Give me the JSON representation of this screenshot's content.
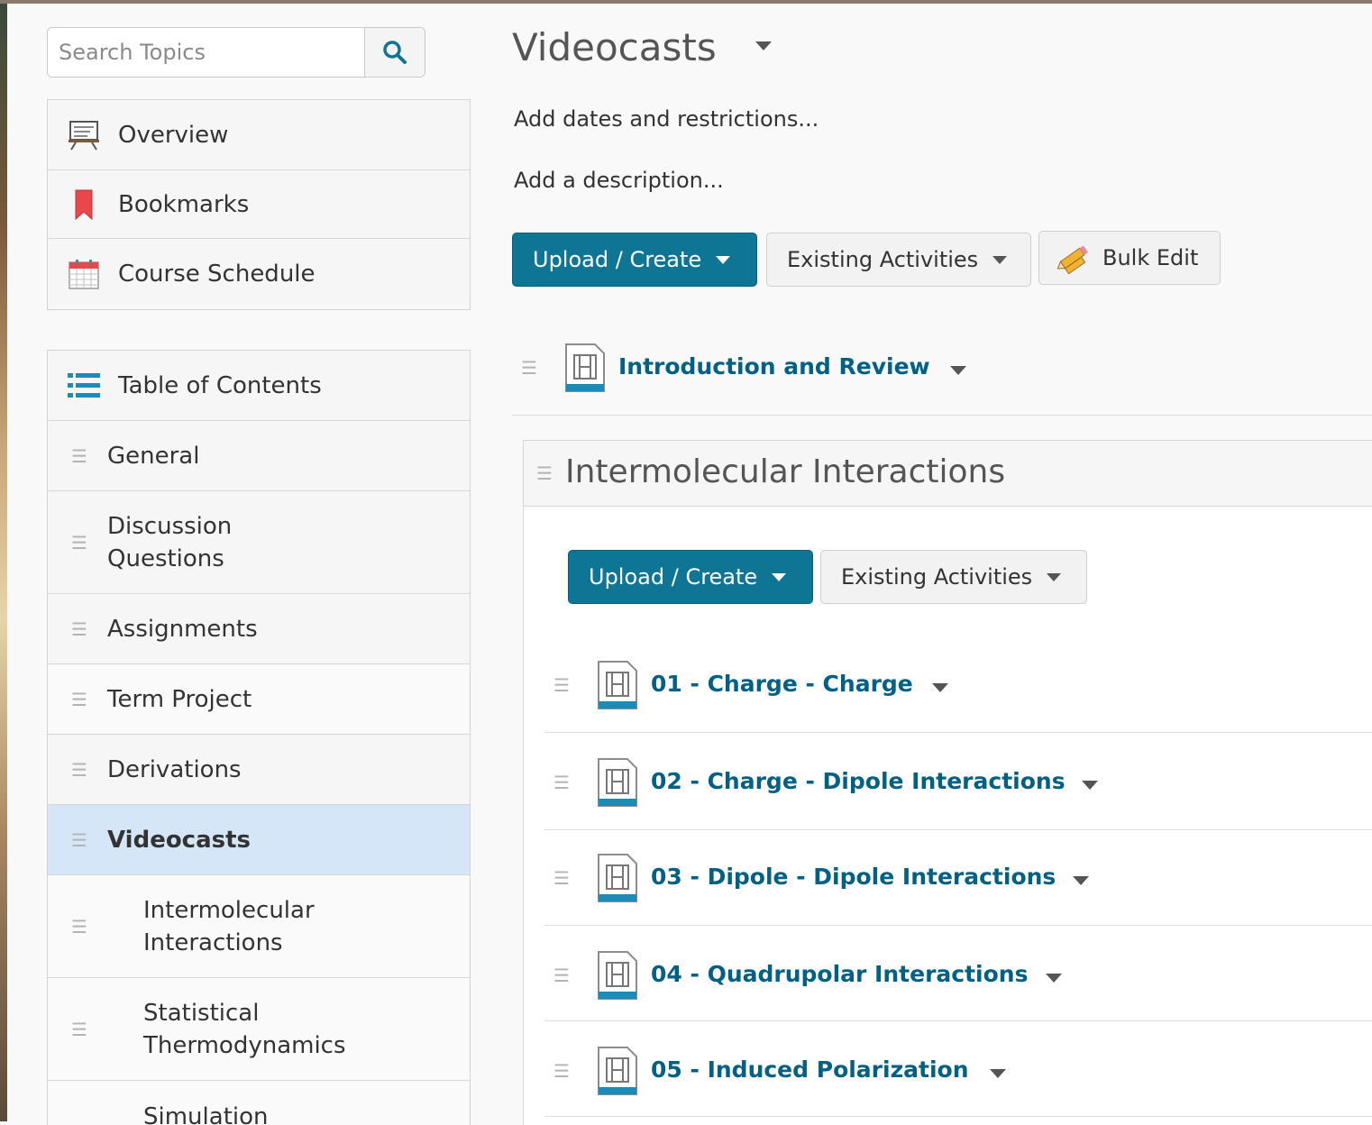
{
  "search": {
    "placeholder": "Search Topics"
  },
  "nav": {
    "items": [
      {
        "label": "Overview",
        "icon": "presentation-board-icon"
      },
      {
        "label": "Bookmarks",
        "icon": "bookmark-icon"
      },
      {
        "label": "Course Schedule",
        "icon": "calendar-icon"
      }
    ]
  },
  "toc": {
    "header": "Table of Contents",
    "items": [
      {
        "label": "General"
      },
      {
        "label": "Discussion\nQuestions"
      },
      {
        "label": "Assignments"
      },
      {
        "label": "Term Project"
      },
      {
        "label": "Derivations"
      },
      {
        "label": "Videocasts"
      },
      {
        "label": "Intermolecular\nInteractions"
      },
      {
        "label": "Statistical\nThermodynamics"
      },
      {
        "label": "Simulation"
      }
    ]
  },
  "main": {
    "title": "Videocasts",
    "add_dates": "Add dates and restrictions...",
    "add_description": "Add a description...",
    "toolbar": {
      "upload_label": "Upload / Create",
      "existing_label": "Existing Activities",
      "bulk_label": "Bulk Edit"
    },
    "topics": [
      {
        "title": "Introduction and Review"
      }
    ],
    "module": {
      "title": "Intermolecular Interactions",
      "toolbar": {
        "upload_label": "Upload / Create",
        "existing_label": "Existing Activities"
      },
      "topics": [
        {
          "title": "01 - Charge - Charge"
        },
        {
          "title": "02 - Charge - Dipole Interactions"
        },
        {
          "title": "03 - Dipole - Dipole Interactions"
        },
        {
          "title": "04 - Quadrupolar Interactions"
        },
        {
          "title": "05 - Induced Polarization"
        }
      ]
    }
  },
  "colors": {
    "accent": "#0e7595",
    "link": "#006085",
    "selected": "#d4e6f8"
  }
}
